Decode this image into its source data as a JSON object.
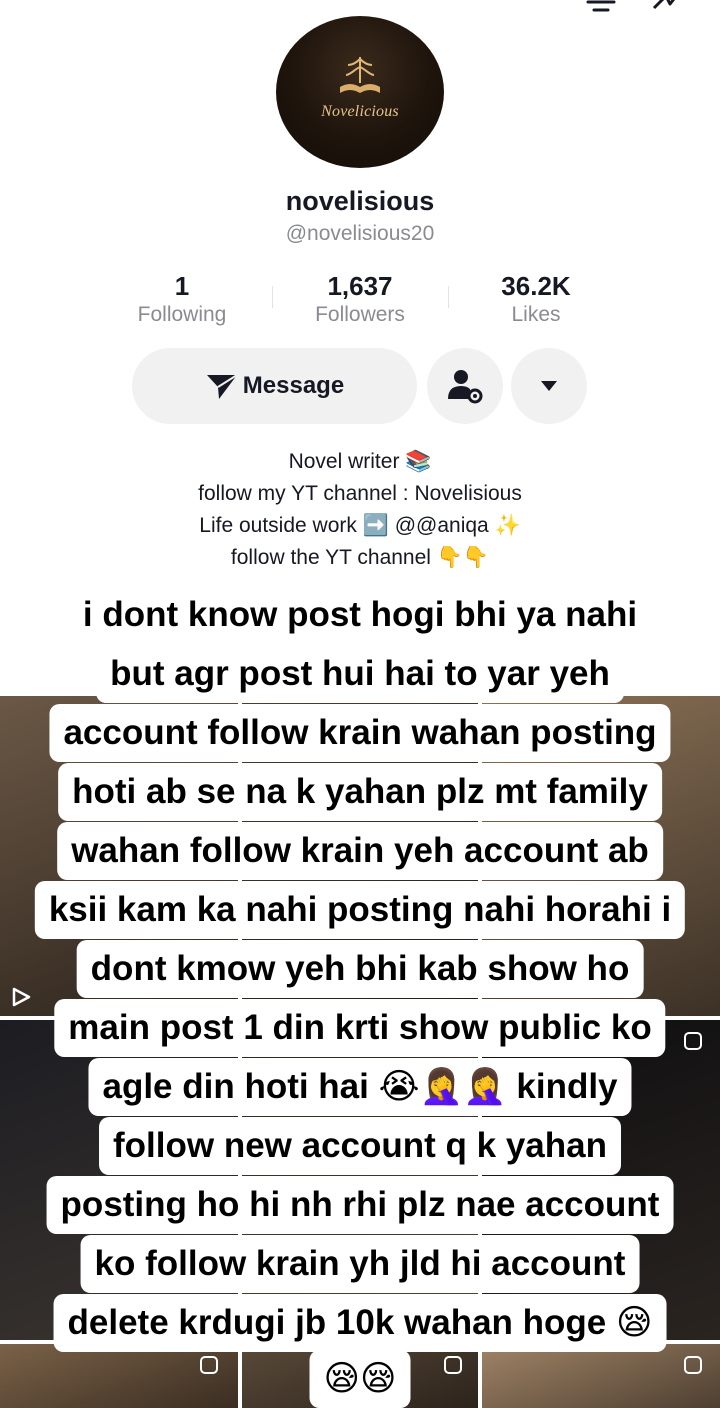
{
  "profile": {
    "avatar_text": "Novelicious",
    "display_name": "novelisious",
    "username": "@novelisious20"
  },
  "stats": [
    {
      "value": "1",
      "label": "Following"
    },
    {
      "value": "1,637",
      "label": "Followers"
    },
    {
      "value": "36.2K",
      "label": "Likes"
    }
  ],
  "actions": {
    "message_label": "Message"
  },
  "bio": [
    "Novel writer 📚",
    "follow my YT channel : Novelisious",
    "Life outside work ➡️ @@aniqa ✨",
    "follow the YT channel 👇👇"
  ],
  "caption": [
    "i dont know post hogi bhi ya nahi",
    "but agr post hui hai to yar yeh",
    "account follow krain wahan posting",
    "hoti ab se na k yahan plz mt family",
    "wahan follow krain yeh account ab",
    "ksii kam ka nahi posting nahi horahi i",
    "dont kmow yeh bhi kab show ho",
    "main post 1 din krti show public ko",
    "agle din hoti hai 😭🤦‍♀️🤦‍♀️ kindly",
    "follow new account q k yahan",
    "posting ho hi nh rhi plz nae account",
    "ko follow krain yh jld hi account",
    "delete krdugi jb 10k wahan hoge 😪",
    "😪😪"
  ],
  "colors": {
    "primary_text": "#161823",
    "secondary_text": "#8a8b91",
    "button_bg": "#f1f1f2",
    "caption_bg": "#ffffff"
  }
}
